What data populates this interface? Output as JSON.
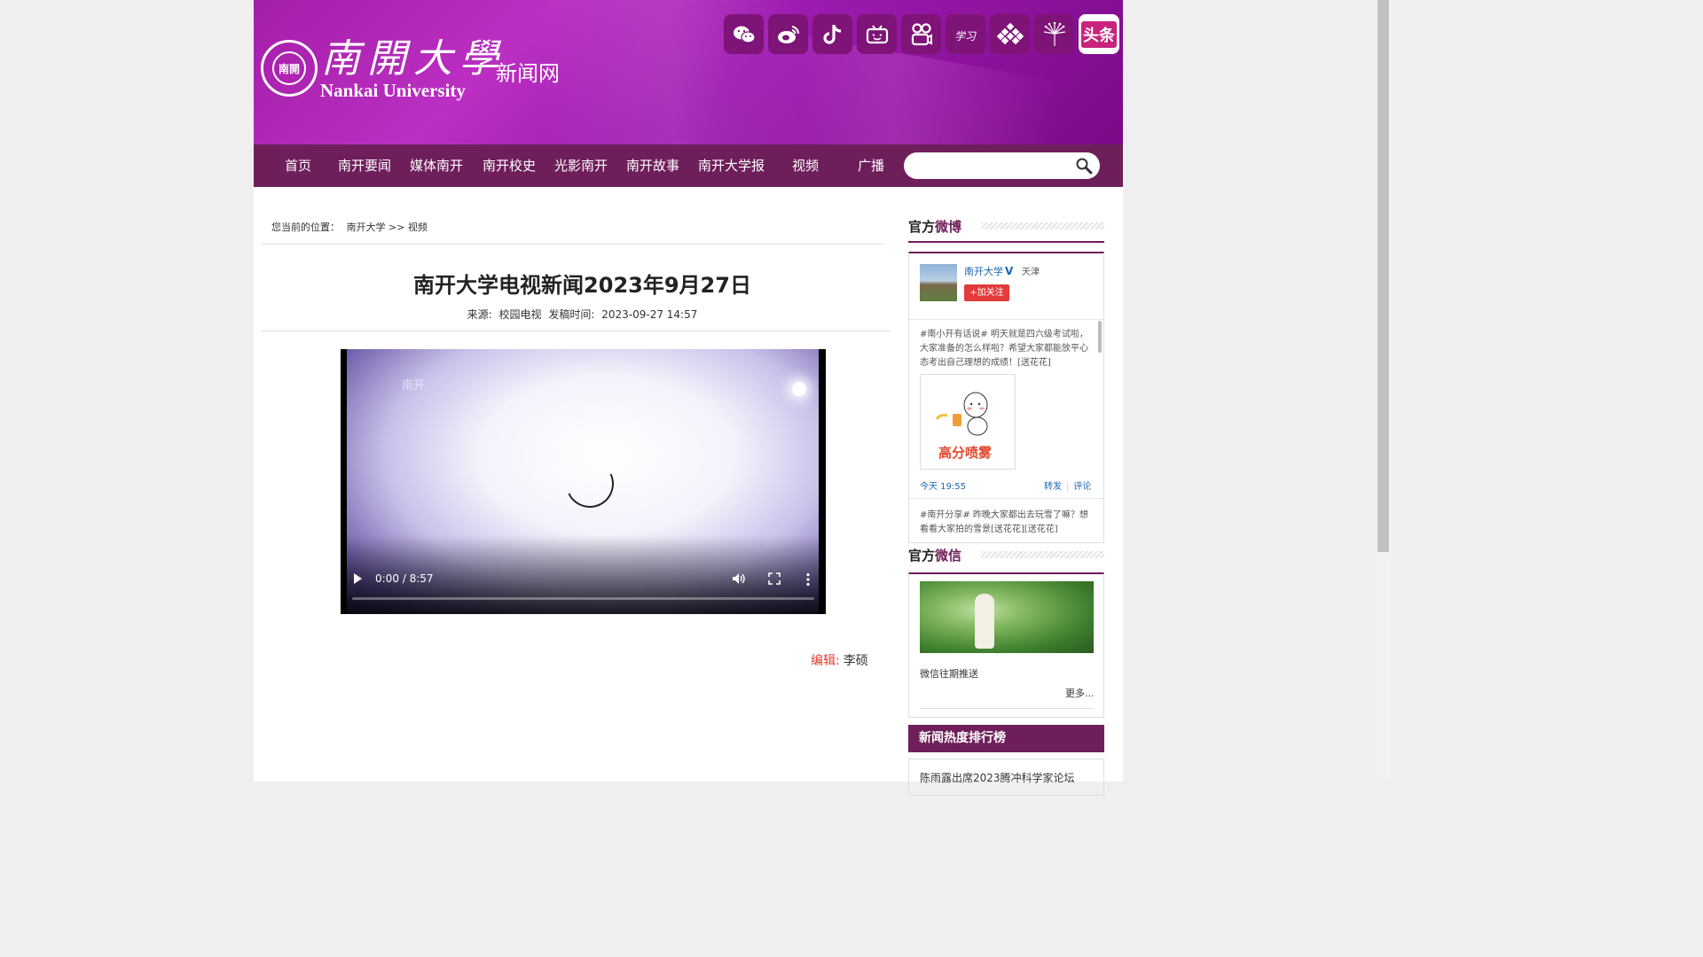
{
  "header": {
    "logo_seal": "南開",
    "logo_cn": "南開大學",
    "logo_en": "Nankai University",
    "site_name": "新闻网",
    "toutiao_label": "头条"
  },
  "socials": [
    "wechat-icon",
    "weibo-icon",
    "douyin-icon",
    "bilibili-icon",
    "kuaishou-icon",
    "xuexi-icon",
    "pattern-icon",
    "dandelion-icon",
    "toutiao-icon"
  ],
  "nav": {
    "items": [
      "首页",
      "南开要闻",
      "媒体南开",
      "南开校史",
      "光影南开",
      "南开故事",
      "南开大学报",
      "视频",
      "广播"
    ],
    "search_placeholder": ""
  },
  "breadcrumb": {
    "label": "您当前的位置：",
    "path": "南开大学 >> 视频"
  },
  "article": {
    "title": "南开大学电视新闻2023年9月27日",
    "source_label": "来源:",
    "source": "校园电视",
    "time_label": "发稿时间:",
    "time": "2023-09-27 14:57",
    "editor_label": "编辑:",
    "editor": "李硕"
  },
  "video": {
    "watermark": "南开",
    "time": "0:00 / 8:57"
  },
  "sidebar": {
    "weibo": {
      "head_a": "官方",
      "head_b": "微博",
      "account": "南开大学",
      "v": "V",
      "location": "天津",
      "follow": "+加关注",
      "post1": "#南小开有话说# 明天就是四六级考试啦，大家准备的怎么样啦？希望大家都能放平心态考出自己理想的成绩！[送花花]",
      "img_text": "高分喷雾",
      "post_time": "今天 19:55",
      "repost": "转发",
      "comment": "评论",
      "post2": "#南开分享# 昨晚大家都出去玩雪了嘛？想看看大家拍的雪景[送花花][送花花]"
    },
    "wechat": {
      "head_a": "官方",
      "head_b": "微信",
      "label": "微信往期推送",
      "more": "更多..."
    },
    "rank": {
      "title": "新闻热度排行榜",
      "items": [
        "陈雨露出席2023腾冲科学家论坛"
      ]
    }
  }
}
